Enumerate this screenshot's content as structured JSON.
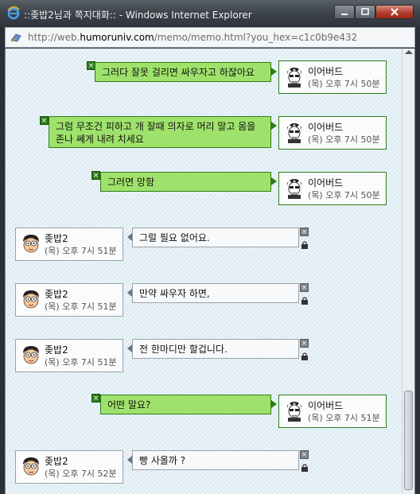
{
  "window": {
    "title": "::좆밥2님과 쪽지대화:: - Windows Internet Explorer",
    "url_prefix": "http://web.",
    "url_host": "humoruniv.com",
    "url_path": "/memo/memo.html?you_hex=c1c0b9e432"
  },
  "icons": {
    "browser": "ie-icon",
    "page": "page-icon",
    "close_message": "close-icon",
    "lock": "lock-icon"
  },
  "colors": {
    "mine_bubble": "#9fe26b",
    "mine_border": "#2e7d1a",
    "theirs_bubble": "#f8f9fa"
  },
  "messages": [
    {
      "side": "mine",
      "text": "그러다 잘못 걸리면 싸우자고 하잖아요",
      "sender": "이어버드",
      "time": "(목) 오후 7시 50분"
    },
    {
      "side": "mine",
      "text": "그럼 무조건 피하고 개 잘때 의자로 머리 말고 몸을 존나 쎄게 내려 치세요",
      "sender": "이어버드",
      "time": "(목) 오후 7시 50분"
    },
    {
      "side": "mine",
      "text": "그러면 망함",
      "sender": "이어버드",
      "time": "(목) 오후 7시 50분"
    },
    {
      "side": "theirs",
      "text": "그럴 필요 없어요.",
      "sender": "좆밥2",
      "time": "(목) 오후 7시 51분"
    },
    {
      "side": "theirs",
      "text": "만약 싸우자 하면,",
      "sender": "좆밥2",
      "time": "(목) 오후 7시 51분"
    },
    {
      "side": "theirs",
      "text": "전 한마디만 할겁니다.",
      "sender": "좆밥2",
      "time": "(목) 오후 7시 51분"
    },
    {
      "side": "mine",
      "text": "어떤 말요?",
      "sender": "이어버드",
      "time": "(목) 오후 7시 51분"
    },
    {
      "side": "theirs",
      "text": "빵 사올까 ?",
      "sender": "좆밥2",
      "time": "(목) 오후 7시 52분"
    }
  ]
}
